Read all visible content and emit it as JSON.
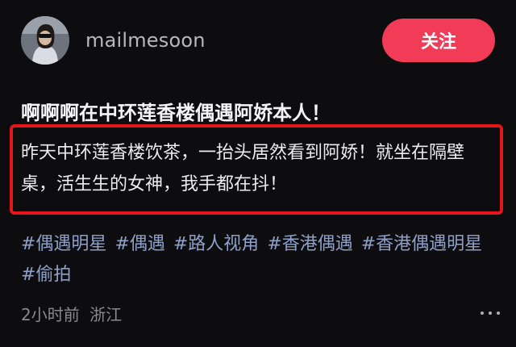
{
  "header": {
    "username": "mailmesoon",
    "follow_label": "关注",
    "avatar_icon": "user-avatar"
  },
  "post": {
    "title": "啊啊啊在中环莲香楼偶遇阿娇本人！",
    "body": "昨天中环莲香楼饮茶，一抬头居然看到阿娇！就坐在隔壁桌，活生生的女神，我手都在抖！",
    "tags": [
      "#偶遇明星",
      "#偶遇",
      "#路人视角",
      "#香港偶遇",
      "#香港偶遇明星",
      "#偷拍"
    ],
    "time": "2小时前",
    "location": "浙江",
    "more_icon": "more-dots-icon"
  },
  "colors": {
    "background": "#0d0d0f",
    "follow_button": "#f23b57",
    "highlight_border": "#e4161c",
    "tag": "#8fa0c8"
  }
}
